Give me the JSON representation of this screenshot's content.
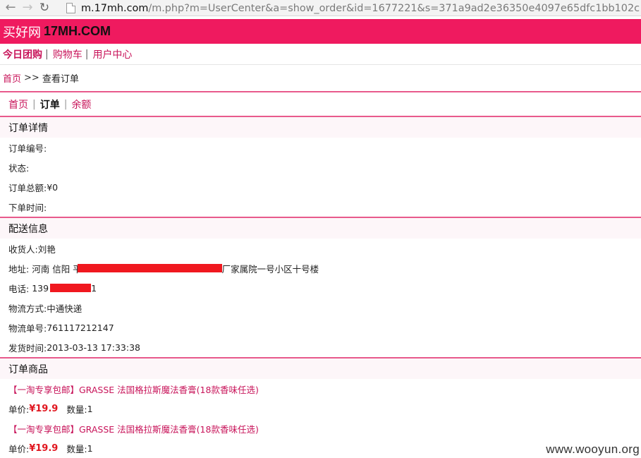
{
  "browser": {
    "url_host": "m.17mh.com",
    "url_path": "/m.php?m=UserCenter&a=show_order&id=1677221&s=371a9ad2e36350e4097e65dfc1bb102c"
  },
  "header": {
    "logo_cn": "买好网",
    "logo_en": "17MH.COM",
    "brand_color": "#ef1a5f"
  },
  "top_nav": {
    "items": [
      {
        "label": "今日团购"
      },
      {
        "label": "购物车"
      },
      {
        "label": "用户中心"
      }
    ],
    "separator": "|"
  },
  "breadcrumb": {
    "home": "首页",
    "arrow": ">>",
    "current": "查看订单"
  },
  "sub_nav": {
    "home": "首页",
    "orders": "订单",
    "balance": "余额",
    "separator": "|"
  },
  "order_detail": {
    "title": "订单详情",
    "order_no_label": "订单编号:",
    "status_label": "状态:",
    "total_label": "订单总额:",
    "total_value": "¥0",
    "time_label": "下单时间:"
  },
  "shipping": {
    "title": "配送信息",
    "receiver_label": "收货人:",
    "receiver_value": "刘艳",
    "address_label": "地址:",
    "address_start": "河南 信阳 平",
    "address_end": "厂家属院一号小区十号楼",
    "phone_label": "电话:",
    "phone_start": "139",
    "phone_end": "1",
    "method_label": "物流方式:",
    "method_value": "中通快递",
    "tracking_label": "物流单号:",
    "tracking_value": "761117212147",
    "ship_time_label": "发货时间:",
    "ship_time_value": "2013-03-13 17:33:38"
  },
  "products": {
    "title": "订单商品",
    "unit_price_label": "单价:",
    "qty_label": "数量:",
    "items": [
      {
        "name": "【一淘专享包邮】GRASSE 法国格拉斯魔法香膏(18款香味任选)",
        "price": "¥19.9",
        "qty": "1"
      },
      {
        "name": "【一淘专享包邮】GRASSE 法国格拉斯魔法香膏(18款香味任选)",
        "price": "¥19.9",
        "qty": "1"
      }
    ]
  },
  "watermark": "www.wooyun.org",
  "icons": {
    "back": "arrow-left-icon",
    "forward": "arrow-right-icon",
    "reload": "reload-icon",
    "page": "page-icon"
  }
}
